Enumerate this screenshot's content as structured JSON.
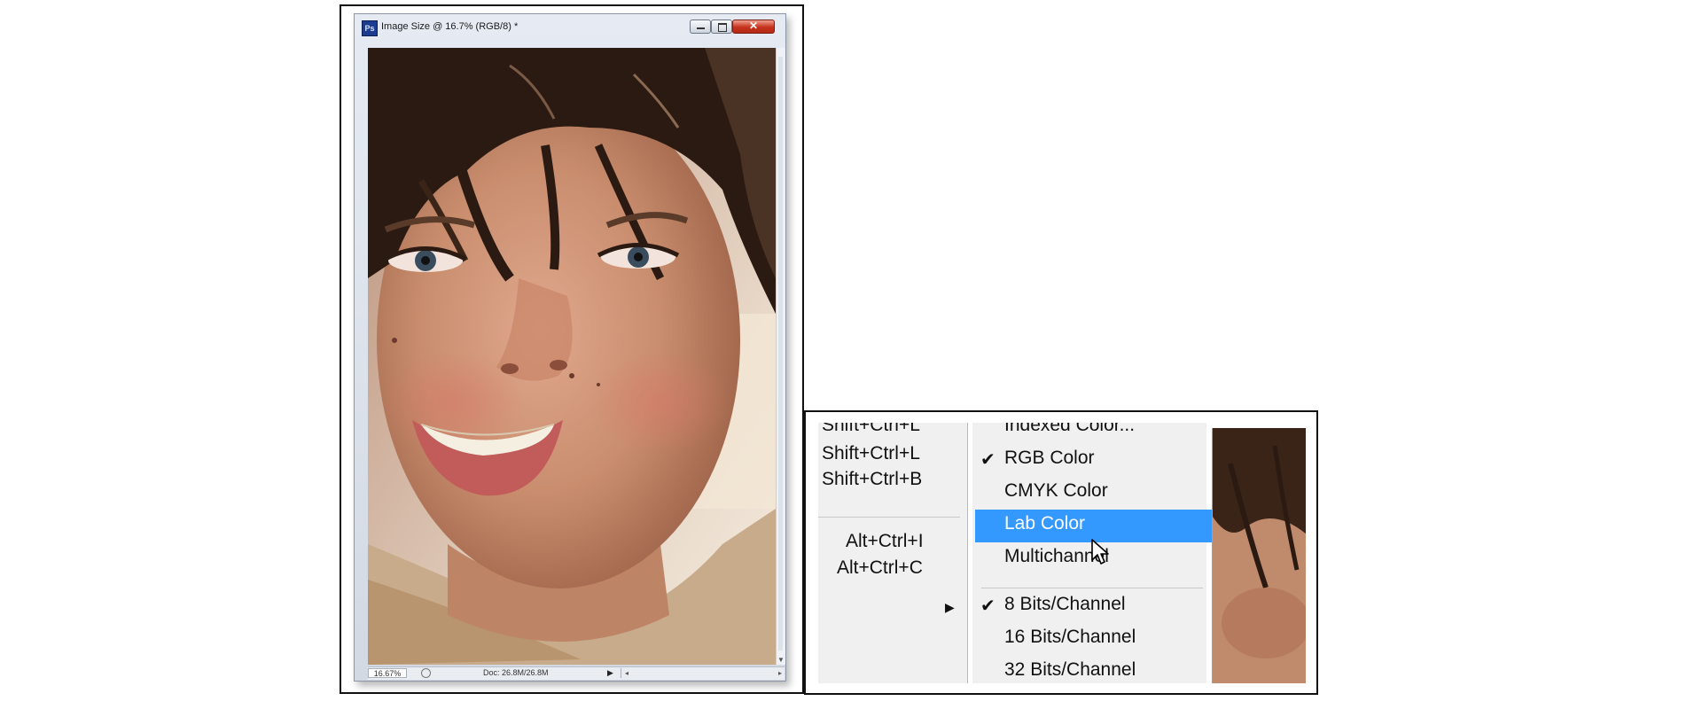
{
  "document_window": {
    "title": "Image Size @ 16.7% (RGB/8) *",
    "app_icon": "Ps",
    "icons": [
      "minimize-icon",
      "maximize-icon",
      "close-icon"
    ],
    "status": {
      "zoom": "16.67%",
      "doc_info": "Doc: 26.8M/26.8M"
    }
  },
  "parent_menu": {
    "shortcuts": [
      "Shift+Ctrl+L",
      "Shift+Ctrl+L",
      "Shift+Ctrl+B",
      "Alt+Ctrl+I",
      "Alt+Ctrl+C"
    ]
  },
  "mode_submenu": {
    "items": [
      {
        "label": "Indexed Color...",
        "checked": false
      },
      {
        "label": "RGB Color",
        "checked": true
      },
      {
        "label": "CMYK Color",
        "checked": false
      },
      {
        "label": "Lab Color",
        "checked": false,
        "highlighted": true
      },
      {
        "label": "Multichannel",
        "checked": false
      },
      {
        "label": "8 Bits/Channel",
        "checked": true
      },
      {
        "label": "16 Bits/Channel",
        "checked": false
      },
      {
        "label": "32 Bits/Channel",
        "checked": false
      }
    ],
    "check_glyph": "✔",
    "highlight_color": "#3399ff"
  }
}
